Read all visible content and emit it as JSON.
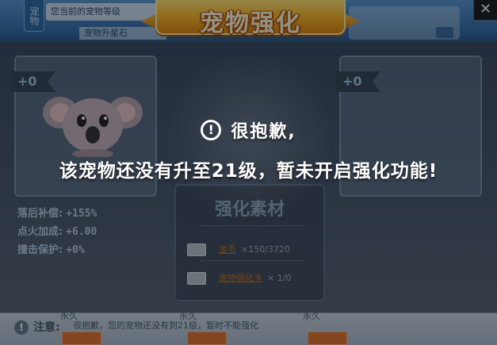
{
  "window": {
    "title": "宠物强化",
    "side_tab": "宠物",
    "info_text": "您当前的宠物等级",
    "info_text2": "宠物升星石",
    "close_symbol": "✕"
  },
  "left_panel": {
    "level": "+0",
    "pet_icon": "koala-pet-icon"
  },
  "right_panel": {
    "level": "+0"
  },
  "stats": [
    {
      "label": "落后补偿:",
      "value": "+155%"
    },
    {
      "label": "点火加成:",
      "value": "+6.00"
    },
    {
      "label": "撞击保护:",
      "value": "+0%"
    }
  ],
  "materials": {
    "title": "强化素材",
    "items": [
      {
        "name": "金币",
        "qty": "×150/3720"
      },
      {
        "name": "宠物强化卡",
        "qty": "× 1/0"
      }
    ]
  },
  "notice": {
    "label": "注意:",
    "text": "很抱歉，您的宠物还没有到21级，暂时不能强化",
    "forever_1": "永久",
    "forever_2": "永久",
    "forever_3": "永久"
  },
  "modal": {
    "icon": "!",
    "title": "很抱歉,",
    "message": "该宠物还没有升至21级，暂未开启强化功能!"
  },
  "colors": {
    "accent_gold": "#f7b52a",
    "material_name": "#d0741c"
  }
}
